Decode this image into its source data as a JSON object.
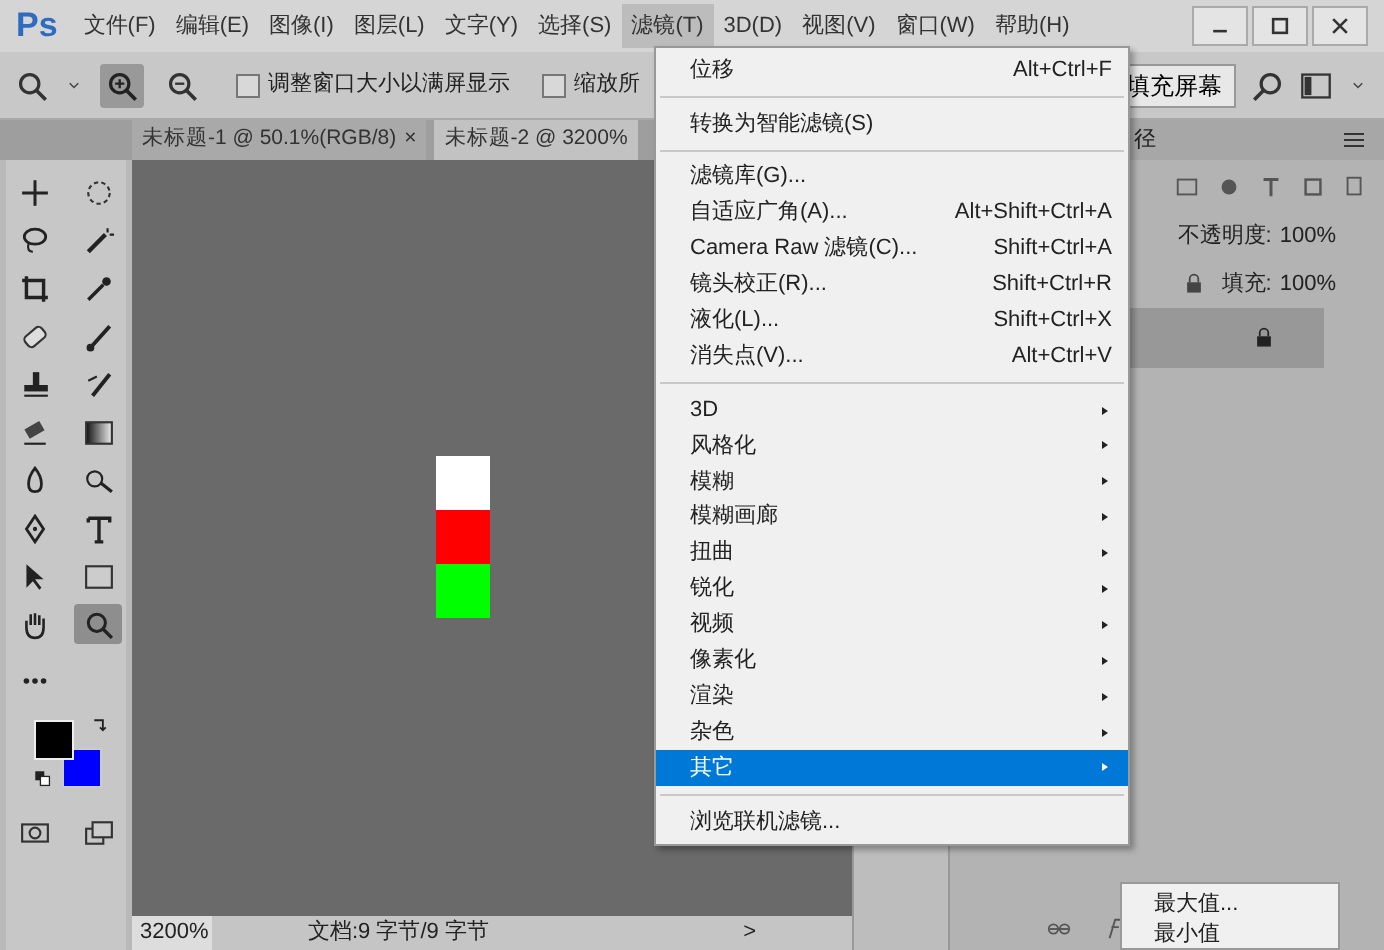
{
  "app": {
    "logo": "Ps"
  },
  "menubar": [
    {
      "label": "文件(F)",
      "selected": false
    },
    {
      "label": "编辑(E)",
      "selected": false
    },
    {
      "label": "图像(I)",
      "selected": false
    },
    {
      "label": "图层(L)",
      "selected": false
    },
    {
      "label": "文字(Y)",
      "selected": false
    },
    {
      "label": "选择(S)",
      "selected": false
    },
    {
      "label": "滤镜(T)",
      "selected": true
    },
    {
      "label": "3D(D)",
      "selected": false
    },
    {
      "label": "视图(V)",
      "selected": false
    },
    {
      "label": "窗口(W)",
      "selected": false
    },
    {
      "label": "帮助(H)",
      "selected": false
    }
  ],
  "options_bar": {
    "checkboxes": [
      {
        "label": "调整窗口大小以满屏显示",
        "checked": false
      },
      {
        "label": "缩放所",
        "checked": false
      }
    ],
    "fill_button": "填充屏幕"
  },
  "doc_tabs": [
    {
      "title": "未标题-1 @ 50.1%(RGB/8)",
      "close": "×",
      "selected": false
    },
    {
      "title": "未标题-2 @ 3200%",
      "selected": true
    }
  ],
  "canvas_pixels": [
    {
      "color": "#ffffff"
    },
    {
      "color": "#ff0000"
    },
    {
      "color": "#00ff00"
    }
  ],
  "color_swatches": [
    {
      "kind": "foreground",
      "color": "#000000"
    },
    {
      "kind": "background",
      "color": "#0000ff"
    }
  ],
  "status_bar": {
    "zoom": "3200%",
    "doc_info": "文档:9 字节/9 字节",
    "arrow": ">"
  },
  "layers_panel": {
    "tab": "径",
    "opacity_label": "不透明度:",
    "opacity": "100%",
    "fill_label": "填充:",
    "fill": "100%"
  },
  "filter_menu": [
    {
      "kind": "item",
      "label": "位移",
      "shortcut": "Alt+Ctrl+F",
      "selected": false
    },
    {
      "kind": "separator"
    },
    {
      "kind": "item",
      "label": "转换为智能滤镜(S)",
      "selected": false
    },
    {
      "kind": "separator"
    },
    {
      "kind": "item",
      "label": "滤镜库(G)...",
      "selected": false
    },
    {
      "kind": "item",
      "label": "自适应广角(A)...",
      "shortcut": "Alt+Shift+Ctrl+A",
      "selected": false
    },
    {
      "kind": "item",
      "label": "Camera Raw 滤镜(C)...",
      "shortcut": "Shift+Ctrl+A",
      "selected": false
    },
    {
      "kind": "item",
      "label": "镜头校正(R)...",
      "shortcut": "Shift+Ctrl+R",
      "selected": false
    },
    {
      "kind": "item",
      "label": "液化(L)...",
      "shortcut": "Shift+Ctrl+X",
      "selected": false
    },
    {
      "kind": "item",
      "label": "消失点(V)...",
      "shortcut": "Alt+Ctrl+V",
      "selected": false
    },
    {
      "kind": "separator"
    },
    {
      "kind": "submenu",
      "label": "3D",
      "selected": false
    },
    {
      "kind": "submenu",
      "label": "风格化",
      "selected": false
    },
    {
      "kind": "submenu",
      "label": "模糊",
      "selected": false
    },
    {
      "kind": "submenu",
      "label": "模糊画廊",
      "selected": false
    },
    {
      "kind": "submenu",
      "label": "扭曲",
      "selected": false
    },
    {
      "kind": "submenu",
      "label": "锐化",
      "selected": false
    },
    {
      "kind": "submenu",
      "label": "视频",
      "selected": false
    },
    {
      "kind": "submenu",
      "label": "像素化",
      "selected": false
    },
    {
      "kind": "submenu",
      "label": "渲染",
      "selected": false
    },
    {
      "kind": "submenu",
      "label": "杂色",
      "selected": false
    },
    {
      "kind": "submenu",
      "label": "其它",
      "selected": true
    },
    {
      "kind": "separator"
    },
    {
      "kind": "item",
      "label": "浏览联机滤镜...",
      "selected": false
    }
  ],
  "other_submenu": [
    {
      "label": "最大值..."
    },
    {
      "label": "最小值"
    }
  ]
}
